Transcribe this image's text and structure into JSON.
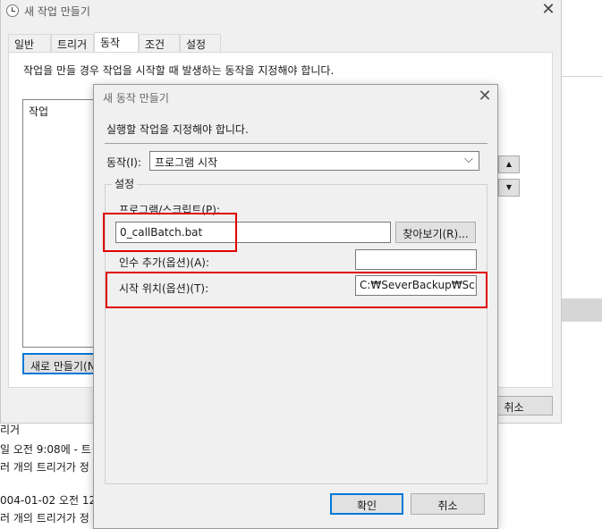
{
  "outer": {
    "title": "새 작업 만들기",
    "tabs": [
      "일반",
      "트리거",
      "동작",
      "조건",
      "설정"
    ],
    "instruction": "작업을 만들 경우 작업을 시작할 때 발생하는 동작을 지정해야 합니다.",
    "list_header": "작업",
    "new_button": "새로 만들기(N...",
    "cancel_button": "취소"
  },
  "background_log": [
    "리거",
    "일 오전 9:08에 - 트",
    "러 개의 트리거가 정",
    "004-01-02 오전 12:",
    "러 개의 트리거가 정"
  ],
  "inner": {
    "title": "새 동작 만들기",
    "instruction": "실행할 작업을 지정해야 합니다.",
    "action_label": "동작(I):",
    "action_value": "프로그램 시작",
    "settings_group": "설정",
    "program_label": "프로그램/스크립트(P):",
    "program_value": "0_callBatch.bat",
    "browse_button": "찾아보기(R)...",
    "args_label": "인수 추가(옵션)(A):",
    "args_value": "",
    "start_label": "시작 위치(옵션)(T):",
    "start_value": "C:₩SeverBackup₩Script",
    "ok_button": "확인",
    "cancel_button": "취소"
  },
  "colors": {
    "highlight": "#e00000",
    "focus": "#0078d7"
  }
}
